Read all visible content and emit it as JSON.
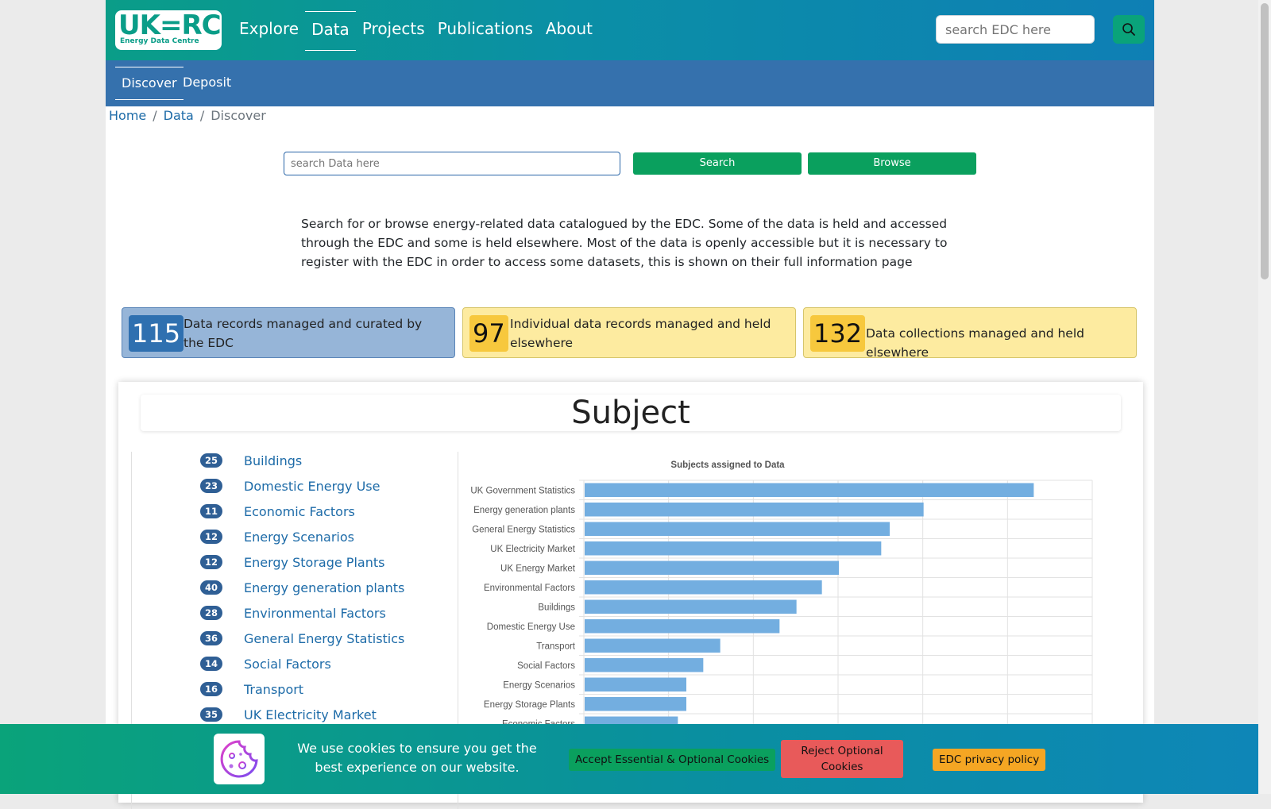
{
  "header": {
    "logo_main": "UK=RC",
    "logo_sub": "Energy Data Centre",
    "nav": [
      "Explore",
      "Data",
      "Projects",
      "Publications",
      "About"
    ],
    "search_placeholder": "search EDC here"
  },
  "subnav": [
    "Discover",
    "Deposit"
  ],
  "breadcrumb": [
    "Home",
    "Data",
    "Discover"
  ],
  "data_search": {
    "placeholder": "search Data here",
    "search_label": "Search",
    "browse_label": "Browse"
  },
  "intro": "Search for or browse energy-related data catalogued by the EDC. Some of the data is held and accessed through the EDC and some is held elsewhere. Most of the data is openly accessible but it is necessary to register with the EDC in order to access some datasets, this is shown on their full information page",
  "stats": [
    {
      "count": "115",
      "label": "Data records managed and curated by the EDC"
    },
    {
      "count": "97",
      "label": "Individual data records managed and held elsewhere"
    },
    {
      "count": "132",
      "label": "Data collections managed and held elsewhere"
    }
  ],
  "subject": {
    "title": "Subject",
    "items": [
      {
        "count": "25",
        "name": "Buildings"
      },
      {
        "count": "23",
        "name": "Domestic Energy Use"
      },
      {
        "count": "11",
        "name": "Economic Factors"
      },
      {
        "count": "12",
        "name": "Energy Scenarios"
      },
      {
        "count": "12",
        "name": "Energy Storage Plants"
      },
      {
        "count": "40",
        "name": "Energy generation plants"
      },
      {
        "count": "28",
        "name": "Environmental Factors"
      },
      {
        "count": "36",
        "name": "General Energy Statistics"
      },
      {
        "count": "14",
        "name": "Social Factors"
      },
      {
        "count": "16",
        "name": "Transport"
      },
      {
        "count": "35",
        "name": "UK Electricity Market"
      }
    ]
  },
  "chart_data": {
    "type": "bar",
    "orientation": "horizontal",
    "title": "Subjects assigned to Data",
    "categories": [
      "UK Government Statistics",
      "Energy generation plants",
      "General Energy Statistics",
      "UK Electricity Market",
      "UK Energy Market",
      "Environmental Factors",
      "Buildings",
      "Domestic Energy Use",
      "Transport",
      "Social Factors",
      "Energy Scenarios",
      "Energy Storage Plants",
      "Economic Factors"
    ],
    "values": [
      53,
      40,
      36,
      35,
      30,
      28,
      25,
      23,
      16,
      14,
      12,
      12,
      11
    ],
    "xlim": [
      0,
      60
    ],
    "grid": true,
    "bar_color": "#73aee0"
  },
  "cookie": {
    "text": "We use cookies to ensure you get the best experience on our website.",
    "accept": "Accept Essential & Optional Cookies",
    "reject": "Reject Optional Cookies",
    "policy": "EDC privacy policy"
  },
  "colors": {
    "brand_green": "#0aa37a",
    "link_blue": "#1d6ba8",
    "subnav_blue": "#3571ad"
  }
}
